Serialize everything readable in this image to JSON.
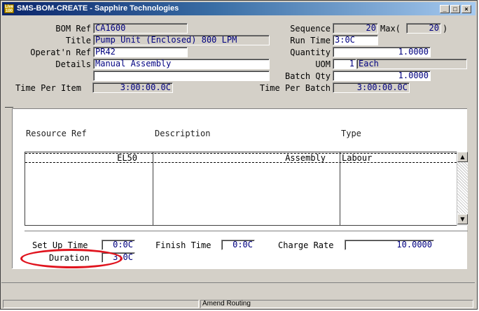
{
  "window": {
    "title": "SMS-BOM-CREATE - Sapphire Technologies",
    "app_icon_text": "Live 100",
    "controls": [
      "_",
      "□",
      "×"
    ]
  },
  "header": {
    "bom_ref_label": "BOM Ref",
    "bom_ref": "CA1600",
    "title_label": "Title",
    "title": "Pump Unit (Enclosed) 800 LPM",
    "operatn_ref_label": "Operat'n Ref",
    "operatn_ref": "PR42",
    "details_label": "Details",
    "details": "Manual Assembly",
    "details2": "",
    "time_per_item_label": "Time Per Item",
    "time_per_item": "3:00:00.0C",
    "sequence_label": "Sequence",
    "sequence": "20",
    "max_label": "Max(",
    "max": "20",
    "max_close": ")",
    "run_time_label": "Run Time",
    "run_time": "3:0C",
    "quantity_label": "Quantity",
    "quantity": "1.0000",
    "uom_label": "UOM",
    "uom_code": "1",
    "uom_name": "Each",
    "batch_qty_label": "Batch Qty",
    "batch_qty": "1.0000",
    "time_per_batch_label": "Time Per Batch",
    "time_per_batch": "3:00:00.0C"
  },
  "resources": {
    "columns": [
      "Resource Ref",
      "Description",
      "Type"
    ],
    "rows": [
      {
        "ref": "EL50",
        "description": "Assembly",
        "type": "Labour"
      }
    ]
  },
  "footer": {
    "setup_time_label": "Set Up Time",
    "setup_time": "0:0C",
    "finish_time_label": "Finish Time",
    "finish_time": "0:0C",
    "charge_rate_label": "Charge Rate",
    "charge_rate": "10.0000",
    "duration_label": "Duration",
    "duration": "3:0C"
  },
  "status": {
    "message": "Amend Routing"
  },
  "colors": {
    "highlight_oval": "#e0141e",
    "field_text": "#000080"
  }
}
